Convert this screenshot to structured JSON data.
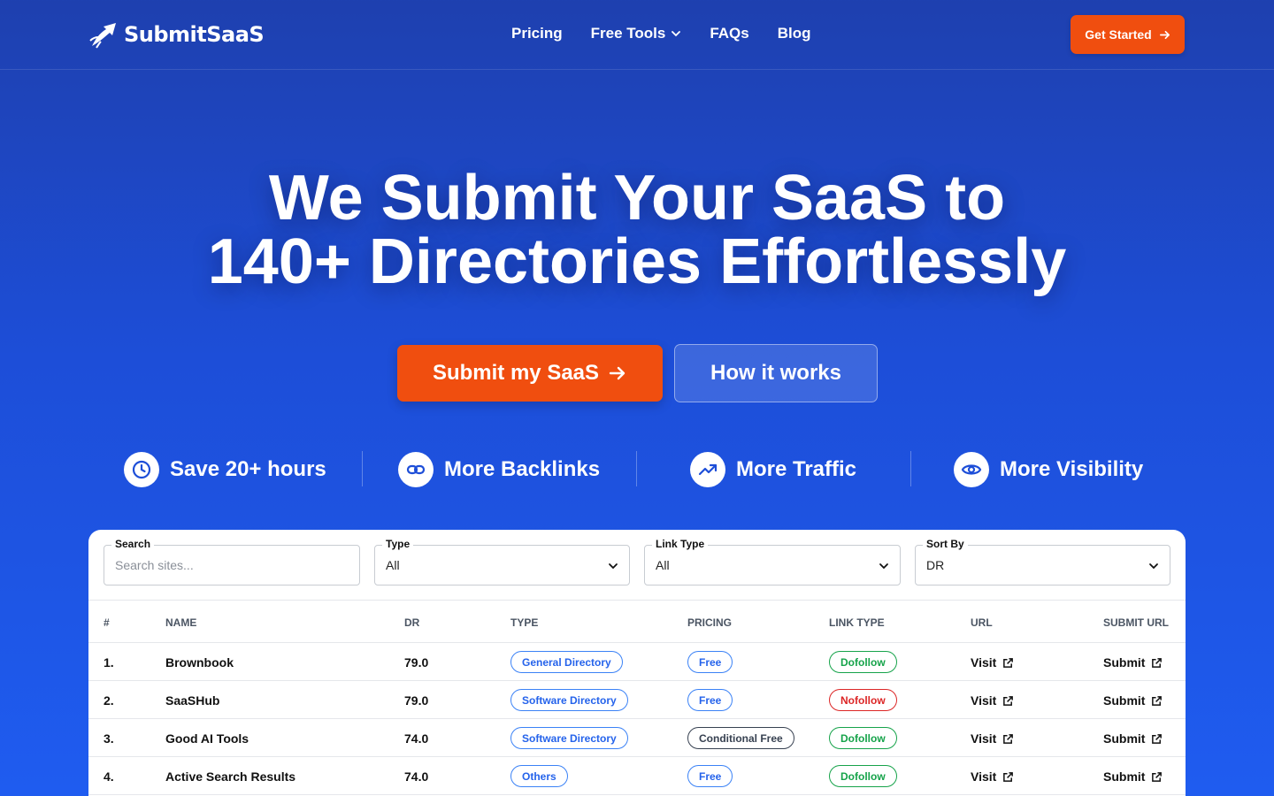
{
  "header": {
    "brand": "SubmitSaaS",
    "nav": [
      {
        "label": "Pricing"
      },
      {
        "label": "Free Tools",
        "has_dropdown": true
      },
      {
        "label": "FAQs"
      },
      {
        "label": "Blog"
      }
    ],
    "cta_label": "Get Started"
  },
  "hero": {
    "title_line1": "We Submit Your SaaS to",
    "title_line2": "140+ Directories Effortlessly",
    "primary_button": "Submit my SaaS",
    "secondary_button": "How it works"
  },
  "features": [
    {
      "label": "Save 20+ hours",
      "icon": "clock-icon"
    },
    {
      "label": "More Backlinks",
      "icon": "link-icon"
    },
    {
      "label": "More Traffic",
      "icon": "trending-up-icon"
    },
    {
      "label": "More Visibility",
      "icon": "eye-icon"
    }
  ],
  "filters": {
    "search": {
      "label": "Search",
      "placeholder": "Search sites..."
    },
    "type": {
      "label": "Type",
      "value": "All"
    },
    "link_type": {
      "label": "Link Type",
      "value": "All"
    },
    "sort_by": {
      "label": "Sort By",
      "value": "DR"
    }
  },
  "table": {
    "columns": [
      "#",
      "NAME",
      "DR",
      "TYPE",
      "PRICING",
      "LINK TYPE",
      "URL",
      "SUBMIT URL"
    ],
    "rows": [
      {
        "num": "1.",
        "name": "Brownbook",
        "dr": "79.0",
        "type": "General Directory",
        "pricing": "Free",
        "link_type": "Dofollow",
        "url_label": "Visit",
        "submit_label": "Submit"
      },
      {
        "num": "2.",
        "name": "SaaSHub",
        "dr": "79.0",
        "type": "Software Directory",
        "pricing": "Free",
        "link_type": "Nofollow",
        "url_label": "Visit",
        "submit_label": "Submit"
      },
      {
        "num": "3.",
        "name": "Good AI Tools",
        "dr": "74.0",
        "type": "Software Directory",
        "pricing": "Conditional Free",
        "link_type": "Dofollow",
        "url_label": "Visit",
        "submit_label": "Submit"
      },
      {
        "num": "4.",
        "name": "Active Search Results",
        "dr": "74.0",
        "type": "Others",
        "pricing": "Free",
        "link_type": "Dofollow",
        "url_label": "Visit",
        "submit_label": "Submit"
      }
    ]
  },
  "colors": {
    "brand_blue": "#1d4ed8",
    "accent_orange": "#f04e0f",
    "dofollow_green": "#16a34a",
    "nofollow_red": "#dc2626",
    "type_blue": "#2563eb"
  }
}
